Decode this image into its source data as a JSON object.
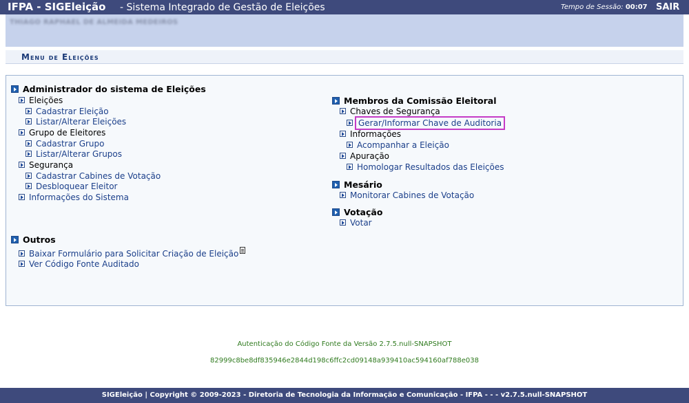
{
  "header": {
    "title": "IFPA - SIGEleição",
    "subtitle": "- Sistema Integrado de Gestão de Eleições",
    "session_label": "Tempo de Sessão:",
    "session_time": "00:07",
    "logout": "SAIR"
  },
  "user": {
    "name": "THIAGO RAPHAEL DE ALMEIDA MEDEIROS"
  },
  "menu_title": "Menu de Eleições",
  "left": {
    "admin": {
      "title": "Administrador do sistema de Eleições",
      "eleicoes": {
        "label": "Eleições",
        "cadastrar": "Cadastrar Eleição",
        "listar": "Listar/Alterar Eleições"
      },
      "grupo": {
        "label": "Grupo de Eleitores",
        "cadastrar": "Cadastrar Grupo",
        "listar": "Listar/Alterar Grupos"
      },
      "seguranca": {
        "label": "Segurança",
        "cabines": "Cadastrar Cabines de Votação",
        "desbloquear": "Desbloquear Eleitor"
      },
      "info": "Informações do Sistema"
    },
    "outros": {
      "title": "Outros",
      "baixar": "Baixar Formulário para Solicitar Criação de Eleição",
      "ver_codigo": "Ver Código Fonte Auditado"
    }
  },
  "right": {
    "comissao": {
      "title": "Membros da Comissão Eleitoral",
      "chaves": {
        "label": "Chaves de Segurança",
        "gerar": "Gerar/Informar Chave de Auditoria"
      },
      "informacoes": {
        "label": "Informações",
        "acompanhar": "Acompanhar a Eleição"
      },
      "apuracao": {
        "label": "Apuração",
        "homologar": "Homologar Resultados das Eleições"
      }
    },
    "mesario": {
      "title": "Mesário",
      "monitorar": "Monitorar Cabines de Votação"
    },
    "votacao": {
      "title": "Votação",
      "votar": "Votar"
    }
  },
  "auth": {
    "line1": "Autenticação do Código Fonte da Versão 2.7.5.null-SNAPSHOT",
    "hash": "82999c8be8df835946e2844d198c6ffc2cd09148a939410ac594160af788e038"
  },
  "footer": {
    "text": "SIGEleição | Copyright © 2009-2023 - Diretoria de Tecnologia da Informação e Comunicação - IFPA - - - v2.7.5.null-SNAPSHOT"
  },
  "colors": {
    "header_bg": "#3e4a7c",
    "user_band": "#c6d2ec",
    "link": "#1b3f8a",
    "highlight": "#c53ac6",
    "auth_text": "#2f7a1e"
  }
}
